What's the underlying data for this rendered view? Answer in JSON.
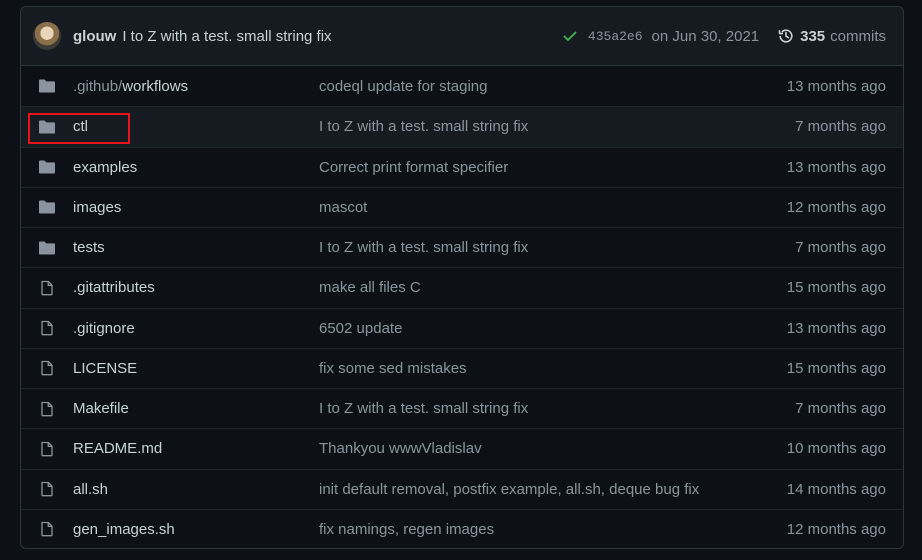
{
  "commit": {
    "author": "glouw",
    "message": "I to Z with a test. small string fix",
    "sha": "435a2e6",
    "date": "on Jun 30, 2021",
    "count": "335",
    "count_label": "commits"
  },
  "colors": {
    "folder": "#8b949e",
    "file": "#8b949e",
    "check": "#3fb950",
    "highlight": "#e5141c"
  },
  "files": [
    {
      "type": "folder",
      "dir": ".github/",
      "name": "workflows",
      "message": "codeql update for staging",
      "age": "13 months ago"
    },
    {
      "type": "folder",
      "dir": "",
      "name": "ctl",
      "message": "I to Z with a test. small string fix",
      "age": "7 months ago"
    },
    {
      "type": "folder",
      "dir": "",
      "name": "examples",
      "message": "Correct print format specifier",
      "age": "13 months ago"
    },
    {
      "type": "folder",
      "dir": "",
      "name": "images",
      "message": "mascot",
      "age": "12 months ago"
    },
    {
      "type": "folder",
      "dir": "",
      "name": "tests",
      "message": "I to Z with a test. small string fix",
      "age": "7 months ago"
    },
    {
      "type": "file",
      "dir": "",
      "name": ".gitattributes",
      "message": "make all files C",
      "age": "15 months ago"
    },
    {
      "type": "file",
      "dir": "",
      "name": ".gitignore",
      "message": "6502 update",
      "age": "13 months ago"
    },
    {
      "type": "file",
      "dir": "",
      "name": "LICENSE",
      "message": "fix some sed mistakes",
      "age": "15 months ago"
    },
    {
      "type": "file",
      "dir": "",
      "name": "Makefile",
      "message": "I to Z with a test. small string fix",
      "age": "7 months ago"
    },
    {
      "type": "file",
      "dir": "",
      "name": "README.md",
      "message": "Thankyou wwwVladislav",
      "age": "10 months ago"
    },
    {
      "type": "file",
      "dir": "",
      "name": "all.sh",
      "message": "init default removal, postfix example, all.sh, deque bug fix",
      "age": "14 months ago"
    },
    {
      "type": "file",
      "dir": "",
      "name": "gen_images.sh",
      "message": "fix namings, regen images",
      "age": "12 months ago"
    }
  ]
}
